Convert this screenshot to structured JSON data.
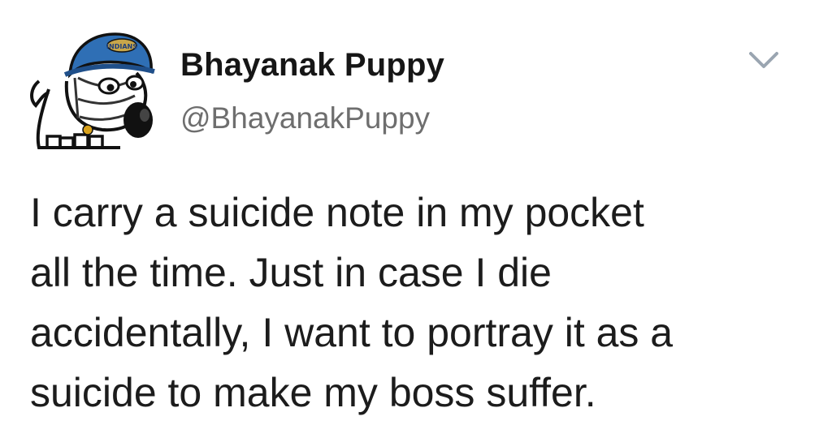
{
  "tweet": {
    "user": {
      "display_name": "Bhayanak Puppy",
      "handle": "@BhayanakPuppy",
      "avatar_icon": "cartoon-dog-cricket-helmet-icon",
      "helmet_logo_text": "INDIANS"
    },
    "menu_icon": "chevron-down-icon",
    "text_lines": [
      "I carry a suicide note in my pocket",
      "all the time. Just in case I die",
      "accidentally, I want to portray it as a",
      "suicide to make my boss suffer."
    ],
    "colors": {
      "helmet": "#2f6fb5",
      "name": "#161616",
      "handle": "#6e6e6e",
      "chevron": "#9aa5b1"
    }
  }
}
